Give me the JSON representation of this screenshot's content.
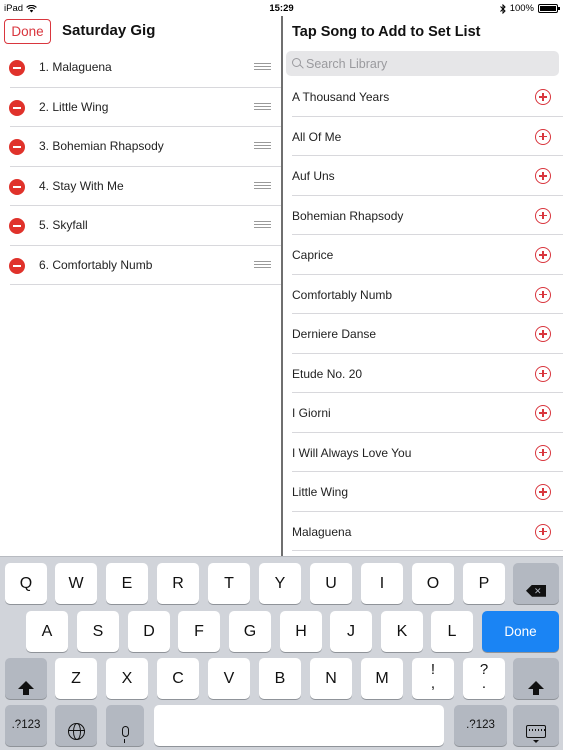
{
  "status_bar": {
    "device": "iPad",
    "time": "15:29",
    "battery": "100%"
  },
  "set_list": {
    "done_label": "Done",
    "title": "Saturday Gig",
    "items": [
      {
        "label": "1. Malaguena"
      },
      {
        "label": "2. Little Wing"
      },
      {
        "label": "3. Bohemian Rhapsody"
      },
      {
        "label": "4. Stay With Me"
      },
      {
        "label": "5. Skyfall"
      },
      {
        "label": "6. Comfortably Numb"
      }
    ]
  },
  "library": {
    "title": "Tap Song to Add to Set List",
    "search_placeholder": "Search Library",
    "items": [
      {
        "label": "A Thousand Years"
      },
      {
        "label": "All Of Me"
      },
      {
        "label": "Auf Uns"
      },
      {
        "label": "Bohemian Rhapsody"
      },
      {
        "label": "Caprice"
      },
      {
        "label": "Comfortably Numb"
      },
      {
        "label": "Derniere Danse"
      },
      {
        "label": "Etude No. 20"
      },
      {
        "label": "I Giorni"
      },
      {
        "label": "I Will Always Love You"
      },
      {
        "label": "Little Wing"
      },
      {
        "label": "Malaguena"
      }
    ]
  },
  "keyboard": {
    "row1": [
      "Q",
      "W",
      "E",
      "R",
      "T",
      "Y",
      "U",
      "I",
      "O",
      "P"
    ],
    "row2": [
      "A",
      "S",
      "D",
      "F",
      "G",
      "H",
      "J",
      "K",
      "L"
    ],
    "row3": [
      "Z",
      "X",
      "C",
      "V",
      "B",
      "N",
      "M"
    ],
    "punct1_top": "!",
    "punct1_bottom": ",",
    "punct2_top": "?",
    "punct2_bottom": ".",
    "return_label": "Done",
    "numbers_label": ".?123",
    "icons": {
      "backspace": "backspace-icon",
      "shift": "shift-arrow-icon",
      "globe": "globe-icon",
      "mic": "microphone-icon",
      "hide": "keyboard-hide-icon",
      "wifi": "wifi-icon",
      "bluetooth": "bluetooth-icon"
    },
    "accent_color": "#1a84f4"
  },
  "colors": {
    "accent": "#d9363e",
    "delete": "#e0322b"
  }
}
